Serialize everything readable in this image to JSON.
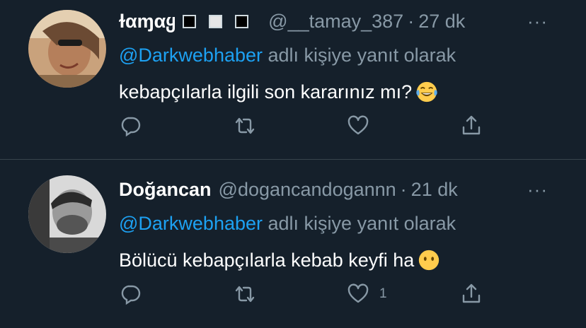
{
  "tweets": [
    {
      "name": "ɫαɱαყ",
      "handle": "@__tamay_387",
      "separator": "·",
      "time": "27 dk",
      "reply_prefix": "",
      "reply_mention": "@Darkwebhaber",
      "reply_suffix": " adlı kişiye yanıt olarak",
      "text": "kebapçılarla ilgili son kararınız mı?",
      "emoji": "laughing-tears-emoji",
      "like_count": "",
      "more": "···"
    },
    {
      "name": "Doğancan",
      "handle": "@dogancandogannn",
      "separator": "·",
      "time": "21 dk",
      "reply_prefix": "",
      "reply_mention": "@Darkwebhaber",
      "reply_suffix": " adlı kişiye yanıt olarak",
      "text": "Bölücü kebapçılarla kebab keyfi ha",
      "emoji": "no-mouth-emoji",
      "like_count": "1",
      "more": "···"
    }
  ],
  "colors": {
    "background": "#15202b",
    "accent": "#1da1f2",
    "muted": "#8899a6",
    "divider": "#38444d"
  },
  "icons": [
    "reply-icon",
    "retweet-icon",
    "like-icon",
    "share-icon",
    "more-icon"
  ]
}
